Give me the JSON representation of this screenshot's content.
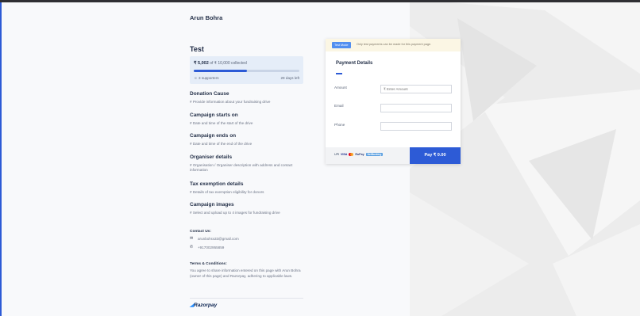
{
  "merchant_name": "Arun Bohra",
  "page_title": "Test",
  "progress": {
    "collected": "₹ 5,002",
    "goal_text": "of ₹ 10,000 collected",
    "fraction": 0.5,
    "supporters": "3 supporters",
    "days_left": "29 days left"
  },
  "sections": [
    {
      "title": "Donation Cause",
      "desc": "# Provide information about your fundraising drive"
    },
    {
      "title": "Campaign starts on",
      "desc": "# Date and time of the start of the drive"
    },
    {
      "title": "Campaign ends on",
      "desc": "# Date and time of the end of the drive"
    },
    {
      "title": "Organiser details",
      "desc": "# Organisation / Organiser description with address and contact information"
    },
    {
      "title": "Tax exemption details",
      "desc": "# Details of tax exemption eligibility for donors"
    },
    {
      "title": "Campaign images",
      "desc": "# Select and upload up to 4 images for fundraising drive"
    }
  ],
  "contact": {
    "heading": "Contact Us:",
    "email": "arunbohra33@gmail.com",
    "phone": "+917002955859"
  },
  "terms": {
    "heading": "Terms & Conditions:",
    "text": "You agree to share information entered on this page with Arun Bohra (owner of this page) and Razorpay, adhering to applicable laws."
  },
  "brand": {
    "logo_text": "Razorpay"
  },
  "payment": {
    "test_badge": "Test Mode",
    "test_note": "Only test payments can be made for this payment page.",
    "title": "Payment Details",
    "fields": [
      {
        "label": "Amount",
        "placeholder": "₹ Enter Amount"
      },
      {
        "label": "Email",
        "placeholder": ""
      },
      {
        "label": "Phone",
        "placeholder": ""
      }
    ],
    "methods": [
      "UPI",
      "VISA",
      "RuPay",
      "NetBanking"
    ],
    "pay_button": "Pay ₹ 0.00"
  },
  "colors": {
    "accent": "#2d5bd6",
    "progress_bg": "#e5edf8",
    "test_badge": "#528ff0"
  }
}
